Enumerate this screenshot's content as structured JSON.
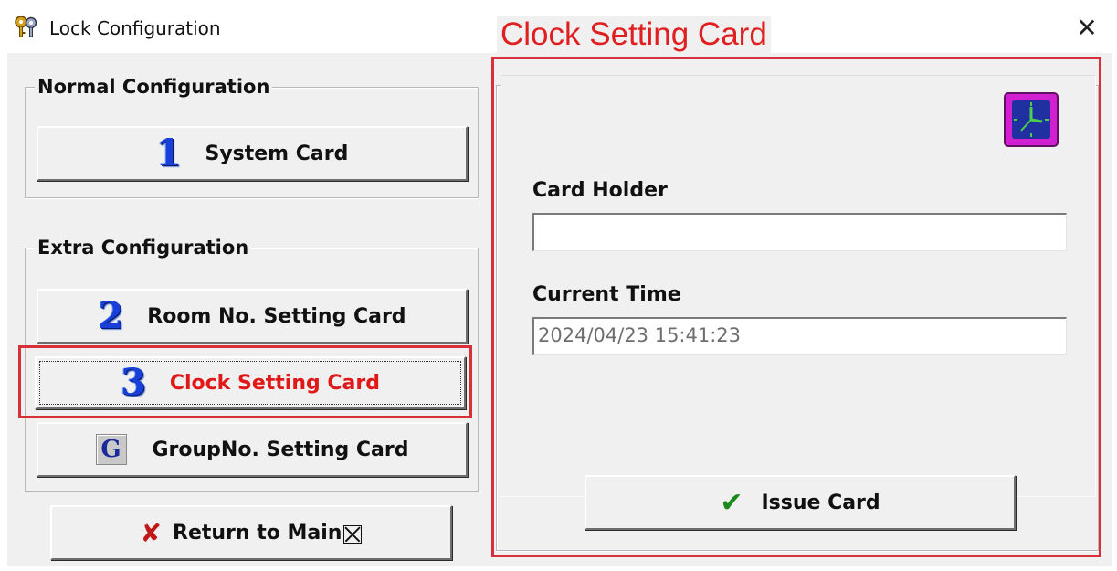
{
  "window": {
    "title": "Lock Configuration",
    "close_glyph": "✕",
    "app_icon": "keys-icon"
  },
  "left": {
    "normal_group": {
      "legend": "Normal Configuration",
      "buttons": [
        {
          "number": "1",
          "label": "System Card"
        }
      ]
    },
    "extra_group": {
      "legend": "Extra Configuration",
      "buttons": [
        {
          "number": "2",
          "label": "Room No. Setting Card"
        },
        {
          "number": "3",
          "label": "Clock Setting Card",
          "active": true
        },
        {
          "icon_letter": "G",
          "label": "GroupNo. Setting Card"
        }
      ]
    },
    "return_button": {
      "label": "Return to Main"
    }
  },
  "right": {
    "legend": "Clock Setting Card",
    "card_holder": {
      "label": "Card Holder",
      "value": ""
    },
    "current_time": {
      "label": "Current Time",
      "value": "2024/04/23 15:41:23"
    },
    "issue_button": {
      "label": "Issue Card"
    },
    "clock_icon": "clock-icon"
  },
  "colors": {
    "highlight_red": "#d8303a",
    "active_text": "#e01818",
    "number_blue": "#1a3fd8",
    "check_green": "#1a8a1a",
    "clock_magenta": "#d020d0"
  }
}
